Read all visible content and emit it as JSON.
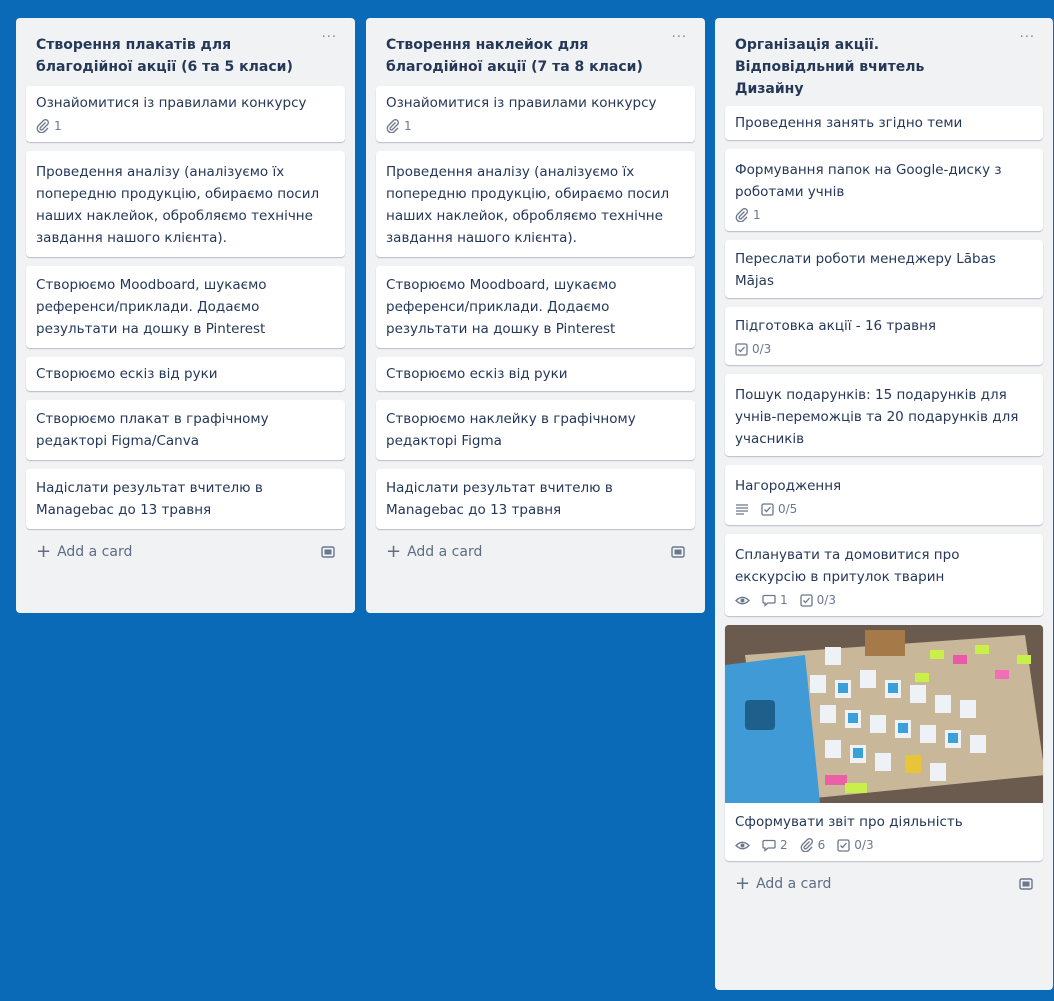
{
  "colors": {
    "board_bg": "#0a6ab7",
    "list_bg": "#f1f2f4",
    "text": "#253858",
    "muted": "#6b778c"
  },
  "lists": [
    {
      "title": "Створення плакатів для\nблагодійної акції (6 та 5 класи)",
      "menu": "···",
      "add_card": "Add a card",
      "cards": [
        {
          "title": "Ознайомитися із правилами конкурсу",
          "attachments": "1"
        },
        {
          "title": "Проведення аналізу (аналізуємо їх попередню продукцію, обираємо посил наших наклейок, обробляємо технічне завдання нашого клієнта)."
        },
        {
          "title": "Створюємо Moodboard, шукаємо референси/приклади. Додаємо результати на дошку в Pinterest"
        },
        {
          "title": "Створюємо ескіз від руки"
        },
        {
          "title": "Створюємо плакат в графічному редакторі Figma/Canva"
        },
        {
          "title": "Надіслати результат вчителю в Managebac до 13 травня"
        }
      ]
    },
    {
      "title": "Створення наклейок для\nблагодійної акції (7 та 8 класи)",
      "menu": "···",
      "add_card": "Add a card",
      "cards": [
        {
          "title": "Ознайомитися із правилами конкурсу",
          "attachments": "1"
        },
        {
          "title": "Проведення аналізу (аналізуємо їх попередню продукцію, обираємо посил наших наклейок, обробляємо технічне завдання нашого клієнта)."
        },
        {
          "title": "Створюємо Moodboard, шукаємо референси/приклади. Додаємо результати на дошку в Pinterest"
        },
        {
          "title": "Створюємо ескіз від руки"
        },
        {
          "title": "Створюємо наклейку в графічному редакторі Figma"
        },
        {
          "title": "Надіслати результат вчителю в Managebac до 13 травня"
        }
      ]
    },
    {
      "title": "Організація акції.\nВідповідльний вчитель\nДизайну",
      "menu": "···",
      "add_card": "Add a card",
      "cards": [
        {
          "title": "Проведення занять згідно теми"
        },
        {
          "title": "Формування папок на Google-диску з роботами учнів",
          "attachments": "1"
        },
        {
          "title": "Переслати роботи менеджеру Lābas Mājas"
        },
        {
          "title": "Підготовка акції - 16 травня",
          "checklist": "0/3"
        },
        {
          "title": "Пошук подарунків: 15 подарунків для учнів-переможців та 20 подарунків для учасників"
        },
        {
          "title": "Нагородження",
          "description_icon": "description-icon",
          "checklist": "0/5"
        },
        {
          "title": "Спланувати та домовитися про екскурсію в притулок тварин",
          "watch_icon": "eye-icon",
          "comments": "1",
          "checklist": "0/3"
        },
        {
          "title": "Сформувати звіт про діяльність",
          "cover": "photo-of-stickers-on-table",
          "watch_icon": "eye-icon",
          "comments": "2",
          "attachments": "6",
          "checklist": "0/3"
        }
      ]
    }
  ]
}
